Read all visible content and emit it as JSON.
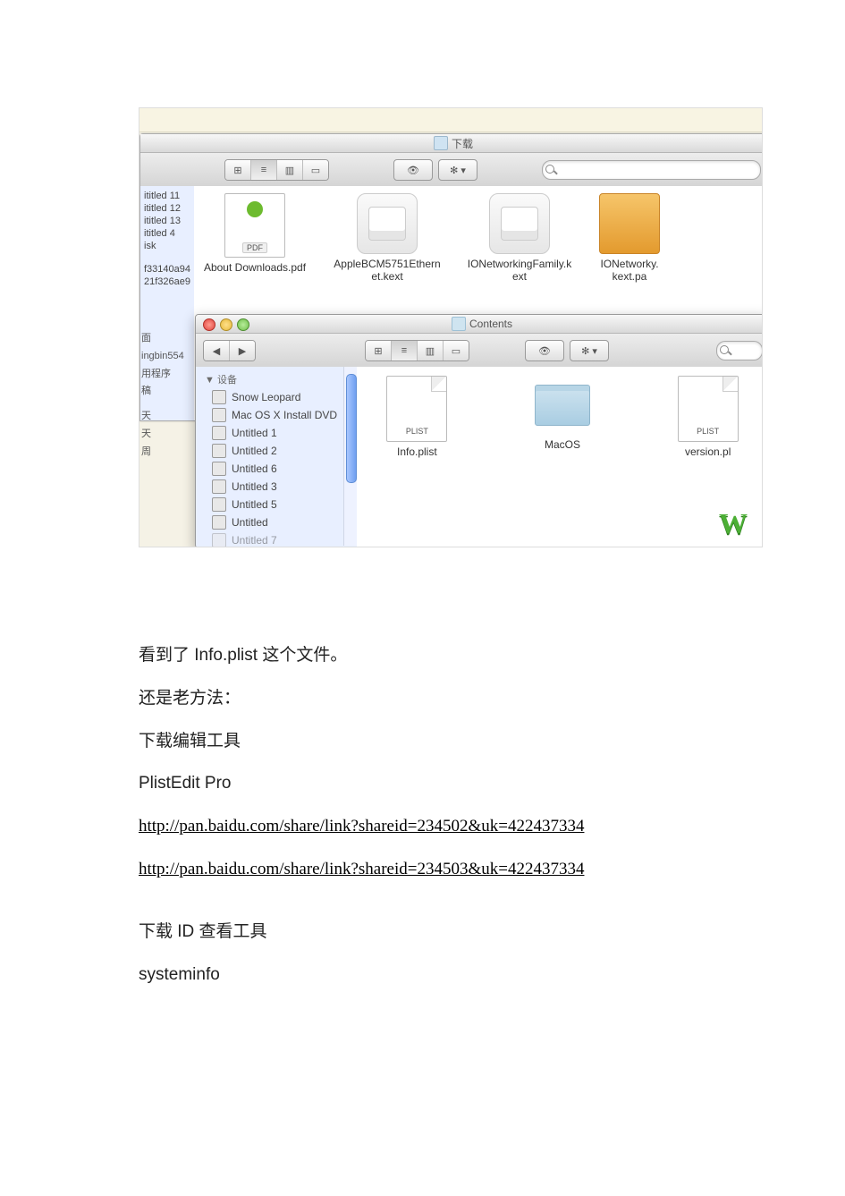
{
  "topbar_stub": "",
  "finder_back": {
    "title": "下载",
    "toolbar": {
      "view_icon": "⊞",
      "view_list": "≡",
      "view_col": "▥",
      "view_flow": "▭",
      "eye": "👁",
      "gear": "✻ ▾",
      "search_placeholder": ""
    },
    "sidebar": {
      "hdr": "",
      "items": [
        "ititled 11",
        "ititled 12",
        "ititled 13",
        "ititled 4",
        "isk",
        "",
        "f33140a94",
        "21f326ae9"
      ]
    },
    "files": [
      {
        "name": "About Downloads.pdf",
        "type": "doc",
        "badge": "PDF"
      },
      {
        "name": "AppleBCM5751Ethernet.kext",
        "type": "kext"
      },
      {
        "name": "IONetworkingFamily.kext",
        "type": "kext"
      },
      {
        "name": "IONetworky.kext.pa",
        "type": "rar"
      }
    ]
  },
  "left_strip": [
    "面",
    "ingbin554",
    "用程序",
    "稿",
    "",
    "天",
    "天",
    "周"
  ],
  "finder_front": {
    "title": "Contents",
    "toolbar": {
      "nav_back": "◀",
      "nav_fwd": "▶",
      "view_icon": "⊞",
      "view_list": "≡",
      "view_col": "▥",
      "view_flow": "▭",
      "eye": "👁",
      "gear": "✻ ▾",
      "search_placeholder": ""
    },
    "sidebar": {
      "section": "▼ 设备",
      "items": [
        "Snow Leopard",
        "Mac OS X Install DVD",
        "Untitled 1",
        "Untitled 2",
        "Untitled 6",
        "Untitled 3",
        "Untitled 5",
        "Untitled",
        "Untitled 7"
      ]
    },
    "files": [
      {
        "name": "Info.plist",
        "type": "plist",
        "tag": "PLIST"
      },
      {
        "name": "MacOS",
        "type": "folder"
      },
      {
        "name": "version.pl",
        "type": "plist",
        "tag": "PLIST"
      }
    ],
    "wo": "W"
  },
  "article": {
    "p1": "看到了 Info.plist 这个文件。",
    "p2": "还是老方法：",
    "p3": "下载编辑工具",
    "p4": "PlistEdit  Pro",
    "link1": " http://pan.baidu.com/share/link?shareid=234502&uk=422437334 ",
    "link2": "http://pan.baidu.com/share/link?shareid=234503&uk=422437334 ",
    "p5": "下载 ID 查看工具",
    "p6": "systeminfo"
  }
}
